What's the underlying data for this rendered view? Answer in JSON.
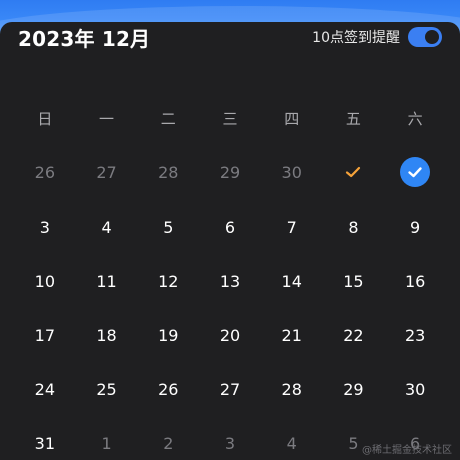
{
  "header": {
    "month_title": "2023年 12月",
    "reminder_label": "10点签到提醒",
    "reminder_on": true
  },
  "weekdays": [
    "日",
    "一",
    "二",
    "三",
    "四",
    "五",
    "六"
  ],
  "weeks": [
    [
      "26",
      "27",
      "28",
      "29",
      "30",
      "",
      ""
    ],
    [
      "3",
      "4",
      "5",
      "6",
      "7",
      "8",
      "9"
    ],
    [
      "10",
      "11",
      "12",
      "13",
      "14",
      "15",
      "16"
    ],
    [
      "17",
      "18",
      "19",
      "20",
      "21",
      "22",
      "23"
    ],
    [
      "24",
      "25",
      "26",
      "27",
      "28",
      "29",
      "30"
    ],
    [
      "31",
      "1",
      "2",
      "3",
      "4",
      "5",
      "6"
    ]
  ],
  "watermark": "@稀土掘金技术社区",
  "colors": {
    "accent": "#2f86f5",
    "checked_orange": "#f5a23a",
    "background": "#1f1f21",
    "muted_text": "#7b7b80"
  },
  "icons": {
    "signed_day": "checkmark-icon",
    "today_signed": "check-circle-icon"
  }
}
